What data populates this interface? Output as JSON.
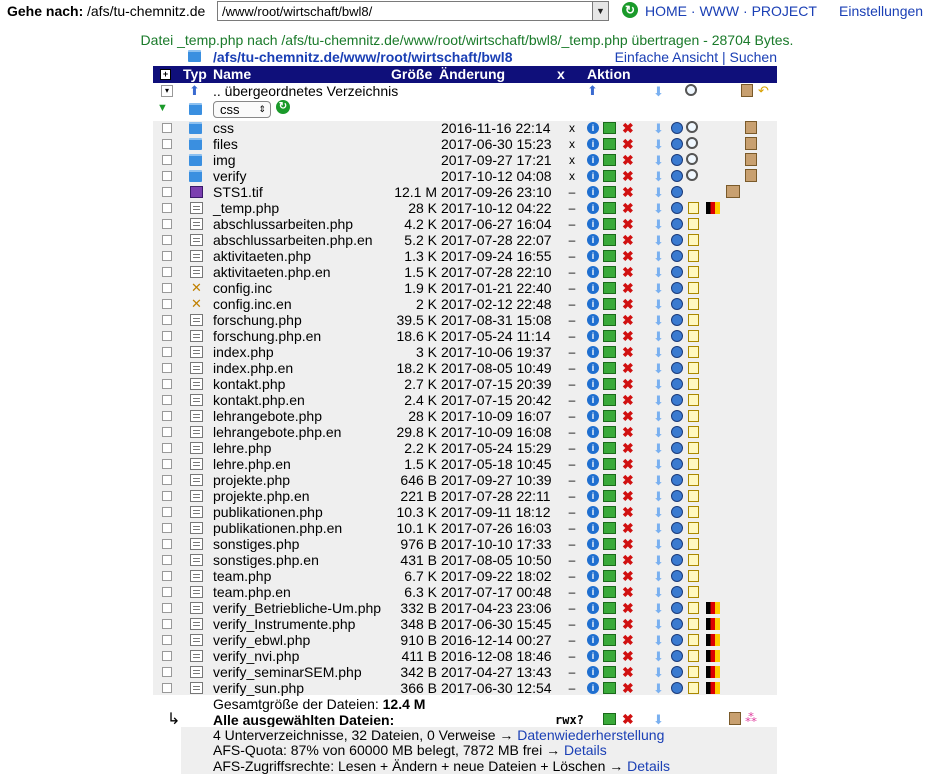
{
  "goto": {
    "label": "Gehe nach:",
    "host": "/afs/tu-chemnitz.de",
    "path": "/www/root/wirtschaft/bwl8/"
  },
  "nav": {
    "home": "HOME",
    "www": "WWW",
    "project": "PROJECT",
    "sep": " · ",
    "settings": "Einstellungen"
  },
  "message": "Datei _temp.php nach /afs/tu-chemnitz.de/www/root/wirtschaft/bwl8/_temp.php übertragen - 28704 Bytes.",
  "path": {
    "text": "/afs/tu-chemnitz.de/www/root/wirtschaft/bwl8",
    "simple_view": "Einfache Ansicht",
    "sep": "|",
    "search": "Suchen"
  },
  "header": {
    "typ": "Typ",
    "name": "Name",
    "size": "Größe",
    "change": "Änderung",
    "x": "x",
    "action": "Aktion"
  },
  "parent": "..  übergeordnetes Verzeichnis",
  "subfolder_select": "css",
  "files": [
    {
      "name": "css",
      "size": "",
      "date": "2016-11-16 22:14",
      "x": "x",
      "type": "folder"
    },
    {
      "name": "files",
      "size": "",
      "date": "2017-06-30 15:23",
      "x": "x",
      "type": "folder"
    },
    {
      "name": "img",
      "size": "",
      "date": "2017-09-27 17:21",
      "x": "x",
      "type": "folder"
    },
    {
      "name": "verify",
      "size": "",
      "date": "2017-10-12 04:08",
      "x": "x",
      "type": "folder"
    },
    {
      "name": "STS1.tif",
      "size": "12.1 M",
      "date": "2017-09-26 23:10",
      "x": "–",
      "type": "image"
    },
    {
      "name": "_temp.php",
      "size": "28 K",
      "date": "2017-10-12 04:22",
      "x": "–",
      "type": "doc"
    },
    {
      "name": "abschlussarbeiten.php",
      "size": "4.2 K",
      "date": "2017-06-27 16:04",
      "x": "–",
      "type": "doc"
    },
    {
      "name": "abschlussarbeiten.php.en",
      "size": "5.2 K",
      "date": "2017-07-28 22:07",
      "x": "–",
      "type": "doc"
    },
    {
      "name": "aktivitaeten.php",
      "size": "1.3 K",
      "date": "2017-09-24 16:55",
      "x": "–",
      "type": "doc"
    },
    {
      "name": "aktivitaeten.php.en",
      "size": "1.5 K",
      "date": "2017-07-28 22:10",
      "x": "–",
      "type": "doc"
    },
    {
      "name": "config.inc",
      "size": "1.9 K",
      "date": "2017-01-21 22:40",
      "x": "–",
      "type": "tool"
    },
    {
      "name": "config.inc.en",
      "size": "2 K",
      "date": "2017-02-12 22:48",
      "x": "–",
      "type": "tool"
    },
    {
      "name": "forschung.php",
      "size": "39.5 K",
      "date": "2017-08-31 15:08",
      "x": "–",
      "type": "doc"
    },
    {
      "name": "forschung.php.en",
      "size": "18.6 K",
      "date": "2017-05-24 11:14",
      "x": "–",
      "type": "doc"
    },
    {
      "name": "index.php",
      "size": "3 K",
      "date": "2017-10-06 19:37",
      "x": "–",
      "type": "doc"
    },
    {
      "name": "index.php.en",
      "size": "18.2 K",
      "date": "2017-08-05 10:49",
      "x": "–",
      "type": "doc"
    },
    {
      "name": "kontakt.php",
      "size": "2.7 K",
      "date": "2017-07-15 20:39",
      "x": "–",
      "type": "doc"
    },
    {
      "name": "kontakt.php.en",
      "size": "2.4 K",
      "date": "2017-07-15 20:42",
      "x": "–",
      "type": "doc"
    },
    {
      "name": "lehrangebote.php",
      "size": "28 K",
      "date": "2017-10-09 16:07",
      "x": "–",
      "type": "doc"
    },
    {
      "name": "lehrangebote.php.en",
      "size": "29.8 K",
      "date": "2017-10-09 16:08",
      "x": "–",
      "type": "doc"
    },
    {
      "name": "lehre.php",
      "size": "2.2 K",
      "date": "2017-05-24 15:29",
      "x": "–",
      "type": "doc"
    },
    {
      "name": "lehre.php.en",
      "size": "1.5 K",
      "date": "2017-05-18 10:45",
      "x": "–",
      "type": "doc"
    },
    {
      "name": "projekte.php",
      "size": "646 B",
      "date": "2017-09-27 10:39",
      "x": "–",
      "type": "doc"
    },
    {
      "name": "projekte.php.en",
      "size": "221 B",
      "date": "2017-07-28 22:11",
      "x": "–",
      "type": "doc"
    },
    {
      "name": "publikationen.php",
      "size": "10.3 K",
      "date": "2017-09-11 18:12",
      "x": "–",
      "type": "doc"
    },
    {
      "name": "publikationen.php.en",
      "size": "10.1 K",
      "date": "2017-07-26 16:03",
      "x": "–",
      "type": "doc"
    },
    {
      "name": "sonstiges.php",
      "size": "976 B",
      "date": "2017-10-10 17:33",
      "x": "–",
      "type": "doc"
    },
    {
      "name": "sonstiges.php.en",
      "size": "431 B",
      "date": "2017-08-05 10:50",
      "x": "–",
      "type": "doc"
    },
    {
      "name": "team.php",
      "size": "6.7 K",
      "date": "2017-09-22 18:02",
      "x": "–",
      "type": "doc"
    },
    {
      "name": "team.php.en",
      "size": "6.3 K",
      "date": "2017-07-17 00:48",
      "x": "–",
      "type": "doc"
    },
    {
      "name": "verify_Betriebliche-Um.php",
      "size": "332 B",
      "date": "2017-04-23 23:06",
      "x": "–",
      "type": "doc"
    },
    {
      "name": "verify_Instrumente.php",
      "size": "348 B",
      "date": "2017-06-30 15:45",
      "x": "–",
      "type": "doc"
    },
    {
      "name": "verify_ebwl.php",
      "size": "910 B",
      "date": "2016-12-14 00:27",
      "x": "–",
      "type": "doc"
    },
    {
      "name": "verify_nvi.php",
      "size": "411 B",
      "date": "2016-12-08 18:46",
      "x": "–",
      "type": "doc"
    },
    {
      "name": "verify_seminarSEM.php",
      "size": "342 B",
      "date": "2017-04-27 13:43",
      "x": "–",
      "type": "doc"
    },
    {
      "name": "verify_sun.php",
      "size": "366 B",
      "date": "2017-06-30 12:54",
      "x": "–",
      "type": "doc"
    }
  ],
  "footer": {
    "total_label": "Gesamtgröße der Dateien:",
    "total_value": "12.4 M",
    "all_selected": "Alle ausgewählten Dateien:",
    "rwx": "rwx?",
    "summary": "4 Unterverzeichnisse, 32 Dateien, 0 Verweise →",
    "summary_link": "Datenwiederherstellung",
    "quota": "AFS-Quota: 87% von 60000 MB belegt, 7872 MB frei →",
    "quota_link": "Details",
    "rights": "AFS-Zugriffsrechte: Lesen + Ändern + neue Dateien + Löschen →",
    "rights_link": "Details"
  }
}
